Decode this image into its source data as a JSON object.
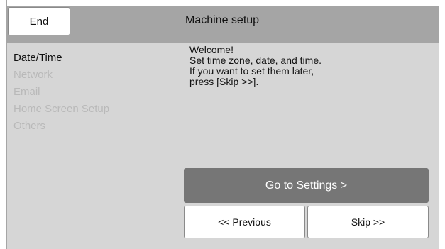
{
  "header": {
    "end_label": "End",
    "title": "Machine setup"
  },
  "sidebar": {
    "items": [
      {
        "label": "Date/Time",
        "active": true
      },
      {
        "label": "Network",
        "active": false
      },
      {
        "label": "Email",
        "active": false
      },
      {
        "label": "Home Screen Setup",
        "active": false
      },
      {
        "label": "Others",
        "active": false
      }
    ]
  },
  "message": {
    "lines": [
      "Welcome!",
      "Set time zone, date, and time.",
      "If you want to set them later,",
      "press [Skip >>]."
    ]
  },
  "actions": {
    "settings_label": "Go to Settings >",
    "previous_label": "<< Previous",
    "skip_label": "Skip >>"
  },
  "colors": {
    "header_bg": "#a5a5a5",
    "panel_bg": "#d6d6d6",
    "primary_button": "#767676",
    "inactive_text": "#b9b9b9"
  }
}
